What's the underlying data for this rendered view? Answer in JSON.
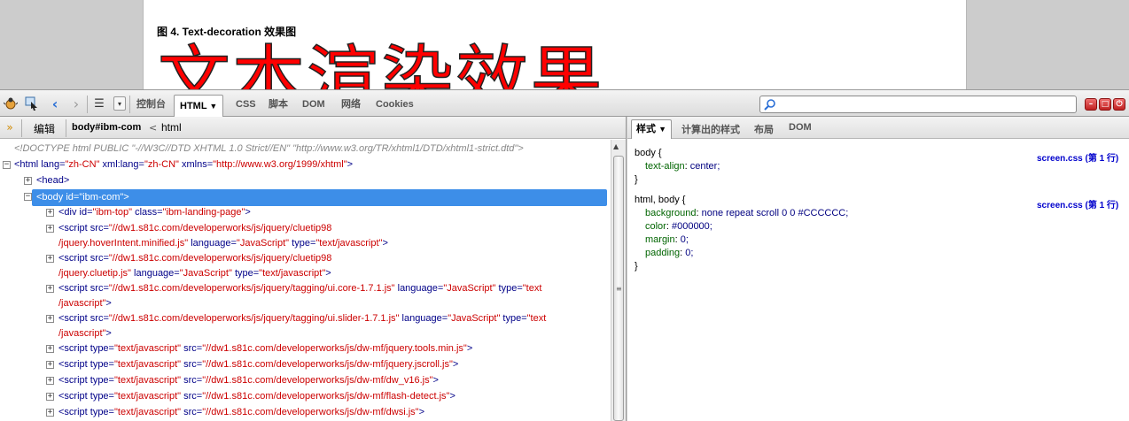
{
  "preview": {
    "caption": "图 4. Text-decoration 效果图",
    "big_text": "文本渲染效果"
  },
  "toolbar": {
    "tabs": [
      "控制台",
      "HTML",
      "CSS",
      "脚本",
      "DOM",
      "网络",
      "Cookies"
    ],
    "active_tab": "HTML",
    "search_placeholder": ""
  },
  "breadcrumb": {
    "edit_label": "编辑",
    "current": "body#ibm-com",
    "separator": "<",
    "parent": "html"
  },
  "html_tree": {
    "doctype": "<!DOCTYPE html PUBLIC \"-//W3C//DTD XHTML 1.0 Strict//EN\" \"http://www.w3.org/TR/xhtml1/DTD/xhtml1-strict.dtd\">",
    "html_open": "<html",
    "html_lang_attr": " lang=",
    "html_lang_val": "\"zh-CN\"",
    "html_xmllang_attr": " xml:lang=",
    "html_xmllang_val": "\"zh-CN\"",
    "html_xmlns_attr": " xmlns=",
    "html_xmlns_val": "\"http://www.w3.org/1999/xhtml\"",
    "html_close": ">",
    "head": "<head>",
    "body_selected": "<body id=\"ibm-com\">",
    "div_open": "<div",
    "div_id_attr": " id=",
    "div_id_val": "\"ibm-top\"",
    "div_class_attr": " class=",
    "div_class_val": "\"ibm-landing-page\"",
    "div_close": ">",
    "s1_line1_tag": "<script",
    "s1_src_attr": " src=",
    "s1_line1_val": "\"//dw1.s81c.com/developerworks/js/jquery/cluetip98",
    "s1_line2_val": "/jquery.hoverIntent.minified.js\"",
    "s1_lang_attr": " language=",
    "s1_lang_val": "\"JavaScript\"",
    "s1_type_attr": " type=",
    "s1_type_val": "\"text/javascript\"",
    "s1_close": ">",
    "s2_line1_tag": "<script",
    "s2_src_attr": " src=",
    "s2_line1_val": "\"//dw1.s81c.com/developerworks/js/jquery/cluetip98",
    "s2_line2_val": "/jquery.cluetip.js\"",
    "s2_lang_attr": " language=",
    "s2_lang_val": "\"JavaScript\"",
    "s2_type_attr": " type=",
    "s2_type_val": "\"text/javascript\"",
    "s2_close": ">",
    "s3_line1_tag": "<script",
    "s3_src_attr": " src=",
    "s3_src_val": "\"//dw1.s81c.com/developerworks/js/jquery/tagging/ui.core-1.7.1.js\"",
    "s3_lang_attr": " language=",
    "s3_lang_val": "\"JavaScript\"",
    "s3_type_attr": " type=",
    "s3_type_val1": "\"text",
    "s3_type_val2": "/javascript\"",
    "s3_close": ">",
    "s4_line1_tag": "<script",
    "s4_src_attr": " src=",
    "s4_src_val": "\"//dw1.s81c.com/developerworks/js/jquery/tagging/ui.slider-1.7.1.js\"",
    "s4_lang_attr": " language=",
    "s4_lang_val": "\"JavaScript\"",
    "s4_type_attr": " type=",
    "s4_type_val1": "\"text",
    "s4_type_val2": "/javascript\"",
    "s4_close": ">",
    "short_scripts": [
      {
        "type_attr": "<script type=",
        "type_val": "\"text/javascript\"",
        "src_attr": " src=",
        "src_val": "\"//dw1.s81c.com/developerworks/js/dw-mf/jquery.tools.min.js\"",
        "close": ">"
      },
      {
        "type_attr": "<script type=",
        "type_val": "\"text/javascript\"",
        "src_attr": " src=",
        "src_val": "\"//dw1.s81c.com/developerworks/js/dw-mf/jquery.jscroll.js\"",
        "close": ">"
      },
      {
        "type_attr": "<script type=",
        "type_val": "\"text/javascript\"",
        "src_attr": " src=",
        "src_val": "\"//dw1.s81c.com/developerworks/js/dw-mf/dw_v16.js\"",
        "close": ">"
      },
      {
        "type_attr": "<script type=",
        "type_val": "\"text/javascript\"",
        "src_attr": " src=",
        "src_val": "\"//dw1.s81c.com/developerworks/js/dw-mf/flash-detect.js\"",
        "close": ">"
      },
      {
        "type_attr": "<script type=",
        "type_val": "\"text/javascript\"",
        "src_attr": " src=",
        "src_val": "\"//dw1.s81c.com/developerworks/js/dw-mf/dwsi.js\"",
        "close": ">"
      }
    ]
  },
  "side_panel": {
    "tabs": [
      "样式",
      "计算出的样式",
      "布局",
      "DOM"
    ],
    "active_tab": "样式",
    "rules": [
      {
        "selector": "body {",
        "source": "screen.css (第 1 行)",
        "props": [
          {
            "name": "text-align",
            "value": "center;"
          }
        ],
        "close": "}"
      },
      {
        "selector": "html, body {",
        "source": "screen.css (第 1 行)",
        "props": [
          {
            "name": "background",
            "value": "none repeat scroll 0 0 #CCCCCC;"
          },
          {
            "name": "color",
            "value": "#000000;"
          },
          {
            "name": "margin",
            "value": "0;"
          },
          {
            "name": "padding",
            "value": "0;"
          }
        ],
        "close": "}"
      }
    ]
  },
  "colors": {
    "selection": "#3d8ee8",
    "tag": "#000088",
    "value": "#cc0000",
    "css_prop": "#006400",
    "css_source": "#0000cc"
  }
}
